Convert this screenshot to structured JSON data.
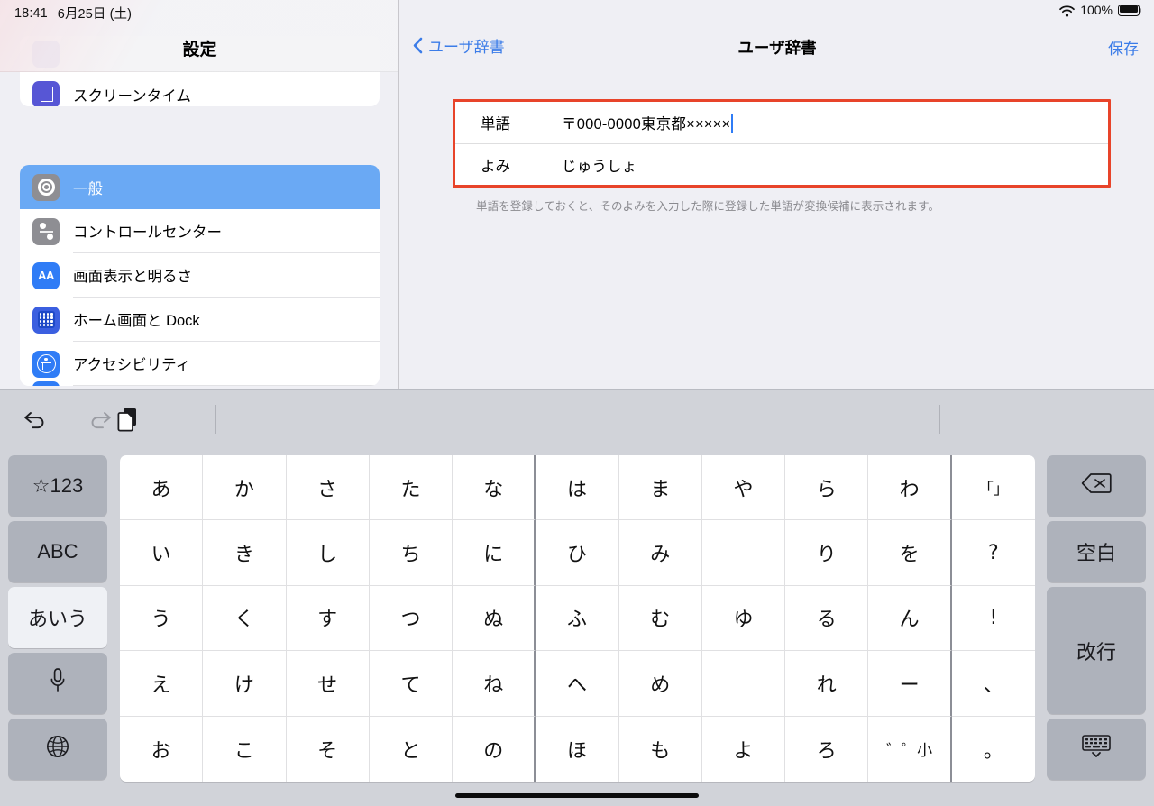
{
  "status_bar": {
    "time": "18:41",
    "date": "6月25日 (土)",
    "wifi_icon": "wifi-icon",
    "battery_percent": "100%",
    "battery_icon": "battery-full-icon"
  },
  "sidebar": {
    "title": "設定",
    "groups": [
      {
        "items": [
          {
            "label": "スクリーンタイム",
            "icon": "hourglass-icon",
            "icon_class": "ic-screentime",
            "selected": false,
            "partial": false
          }
        ]
      },
      {
        "items": [
          {
            "label": "一般",
            "icon": "gear-icon",
            "icon_class": "ic-general",
            "selected": true
          },
          {
            "label": "コントロールセンター",
            "icon": "control-center-icon",
            "icon_class": "ic-control",
            "selected": false
          },
          {
            "label": "画面表示と明るさ",
            "icon": "display-brightness-icon",
            "icon_class": "ic-display",
            "selected": false
          },
          {
            "label": "ホーム画面と Dock",
            "icon": "home-screen-dock-icon",
            "icon_class": "ic-home",
            "selected": false
          },
          {
            "label": "アクセシビリティ",
            "icon": "accessibility-icon",
            "icon_class": "ic-access",
            "selected": false
          }
        ]
      }
    ]
  },
  "detail": {
    "back_label": "ユーザ辞書",
    "back_icon": "chevron-left-icon",
    "title": "ユーザ辞書",
    "save_label": "保存",
    "form": {
      "rows": [
        {
          "label": "単語",
          "value": "〒000-0000東京都×××××",
          "focused": true
        },
        {
          "label": "よみ",
          "value": "じゅうしょ",
          "focused": false
        }
      ],
      "note": "単語を登録しておくと、そのよみを入力した際に登録した単語が変換候補に表示されます。",
      "highlight_color": "#e8442a"
    }
  },
  "keyboard": {
    "toolbar": [
      {
        "name": "undo-icon",
        "enabled": true
      },
      {
        "name": "redo-icon",
        "enabled": false
      },
      {
        "name": "paste-icon",
        "enabled": true
      }
    ],
    "left_keys": [
      {
        "label": "☆123",
        "name": "symbols-123-key",
        "active": false
      },
      {
        "label": "ABC",
        "name": "abc-key",
        "active": false
      },
      {
        "label": "あいう",
        "name": "aiu-kana-key",
        "active": true
      },
      {
        "label": "",
        "name": "microphone-key",
        "icon": "microphone-icon",
        "active": false
      },
      {
        "label": "",
        "name": "globe-key",
        "icon": "globe-icon",
        "active": false
      }
    ],
    "right_keys": [
      {
        "label": "",
        "name": "delete-key",
        "icon": "backspace-icon"
      },
      {
        "label": "空白",
        "name": "space-key"
      },
      {
        "label": "改行",
        "name": "return-key"
      },
      {
        "label": "",
        "name": "dismiss-keyboard-key",
        "icon": "keyboard-dismiss-icon"
      }
    ],
    "kana_rows": [
      [
        "あ",
        "か",
        "さ",
        "た",
        "な",
        "は",
        "ま",
        "や",
        "ら",
        "わ",
        "「」"
      ],
      [
        "い",
        "き",
        "し",
        "ち",
        "に",
        "ひ",
        "み",
        "",
        "り",
        "を",
        "?"
      ],
      [
        "う",
        "く",
        "す",
        "つ",
        "ぬ",
        "ふ",
        "む",
        "ゆ",
        "る",
        "ん",
        "!"
      ],
      [
        "え",
        "け",
        "せ",
        "て",
        "ね",
        "へ",
        "め",
        "",
        "れ",
        "ー",
        "、"
      ],
      [
        "お",
        "こ",
        "そ",
        "と",
        "の",
        "ほ",
        "も",
        "よ",
        "ろ",
        "゛゜小",
        "。"
      ]
    ]
  },
  "colors": {
    "accent_blue": "#3b7ce8",
    "selection_blue": "#6aa9f4",
    "highlight_red": "#e8442a",
    "keyboard_bg": "#d1d3d9",
    "function_key": "#aeb2bb"
  }
}
